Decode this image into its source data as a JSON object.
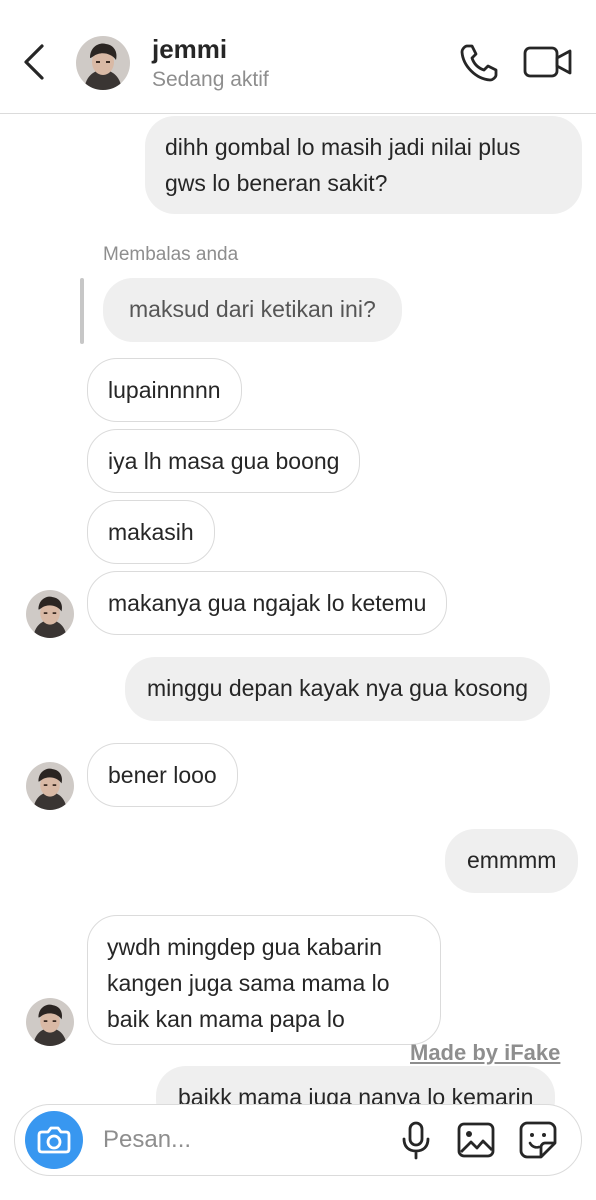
{
  "header": {
    "name": "jemmi",
    "status": "Sedang aktif",
    "icons": [
      "back-chevron-icon",
      "avatar",
      "phone-icon",
      "video-camera-icon"
    ]
  },
  "messages": [
    {
      "type": "sent",
      "lines": [
        "dihh gombal lo masih jadi nilai plus",
        "gws lo beneran sakit?"
      ]
    },
    {
      "type": "reply",
      "label": "Membalas anda",
      "text": "maksud dari ketikan ini?"
    },
    {
      "type": "received",
      "text": "lupainnnnn"
    },
    {
      "type": "received",
      "text": "iya lh masa gua boong"
    },
    {
      "type": "received",
      "text": "makasih"
    },
    {
      "type": "received",
      "text": "makanya gua ngajak lo ketemu"
    },
    {
      "type": "sent",
      "text": "minggu depan kayak nya gua kosong"
    },
    {
      "type": "received",
      "text": "bener looo"
    },
    {
      "type": "sent",
      "text": "emmmm"
    },
    {
      "type": "received",
      "lines": [
        "ywdh mingdep gua kabarin",
        "kangen juga sama mama lo",
        "baik kan mama papa lo"
      ]
    },
    {
      "type": "sent",
      "text": "baikk mama juga nanya lo kemarin"
    }
  ],
  "watermark": "Made by iFake",
  "composer": {
    "placeholder": "Pesan...",
    "icons": [
      "camera-icon",
      "microphone-icon",
      "gallery-icon",
      "sticker-icon"
    ]
  },
  "colors": {
    "accent": "#3897f0",
    "sent_bubble": "#efefef",
    "border": "#dbdbdb",
    "muted": "#8e8e8e"
  }
}
